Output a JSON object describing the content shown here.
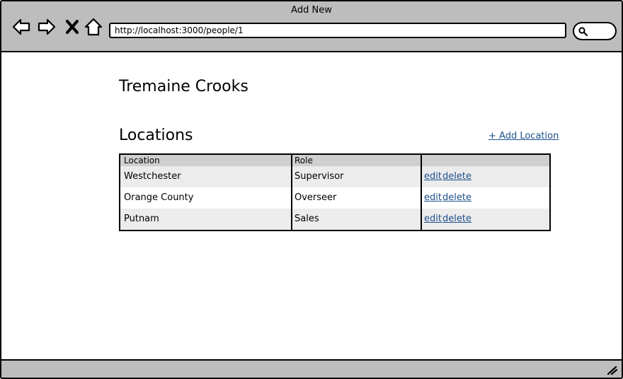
{
  "window": {
    "title": "Add New"
  },
  "browser": {
    "url": "http://localhost:3000/people/1",
    "icons": [
      "back-arrow-icon",
      "forward-arrow-icon",
      "close-x-icon",
      "home-icon",
      "search-icon",
      "resize-grip-icon"
    ]
  },
  "page": {
    "person_name": "Tremaine Crooks",
    "locations_heading": "Locations",
    "add_location_label": "+ Add Location"
  },
  "table": {
    "headers": [
      "Location",
      "Role",
      ""
    ],
    "rows": [
      {
        "location": "Westchester",
        "role": "Supervisor",
        "edit": "edit",
        "delete": "delete"
      },
      {
        "location": "Orange County",
        "role": "Overseer",
        "edit": "edit",
        "delete": "delete"
      },
      {
        "location": "Putnam",
        "role": "Sales",
        "edit": "edit",
        "delete": "delete"
      }
    ]
  }
}
